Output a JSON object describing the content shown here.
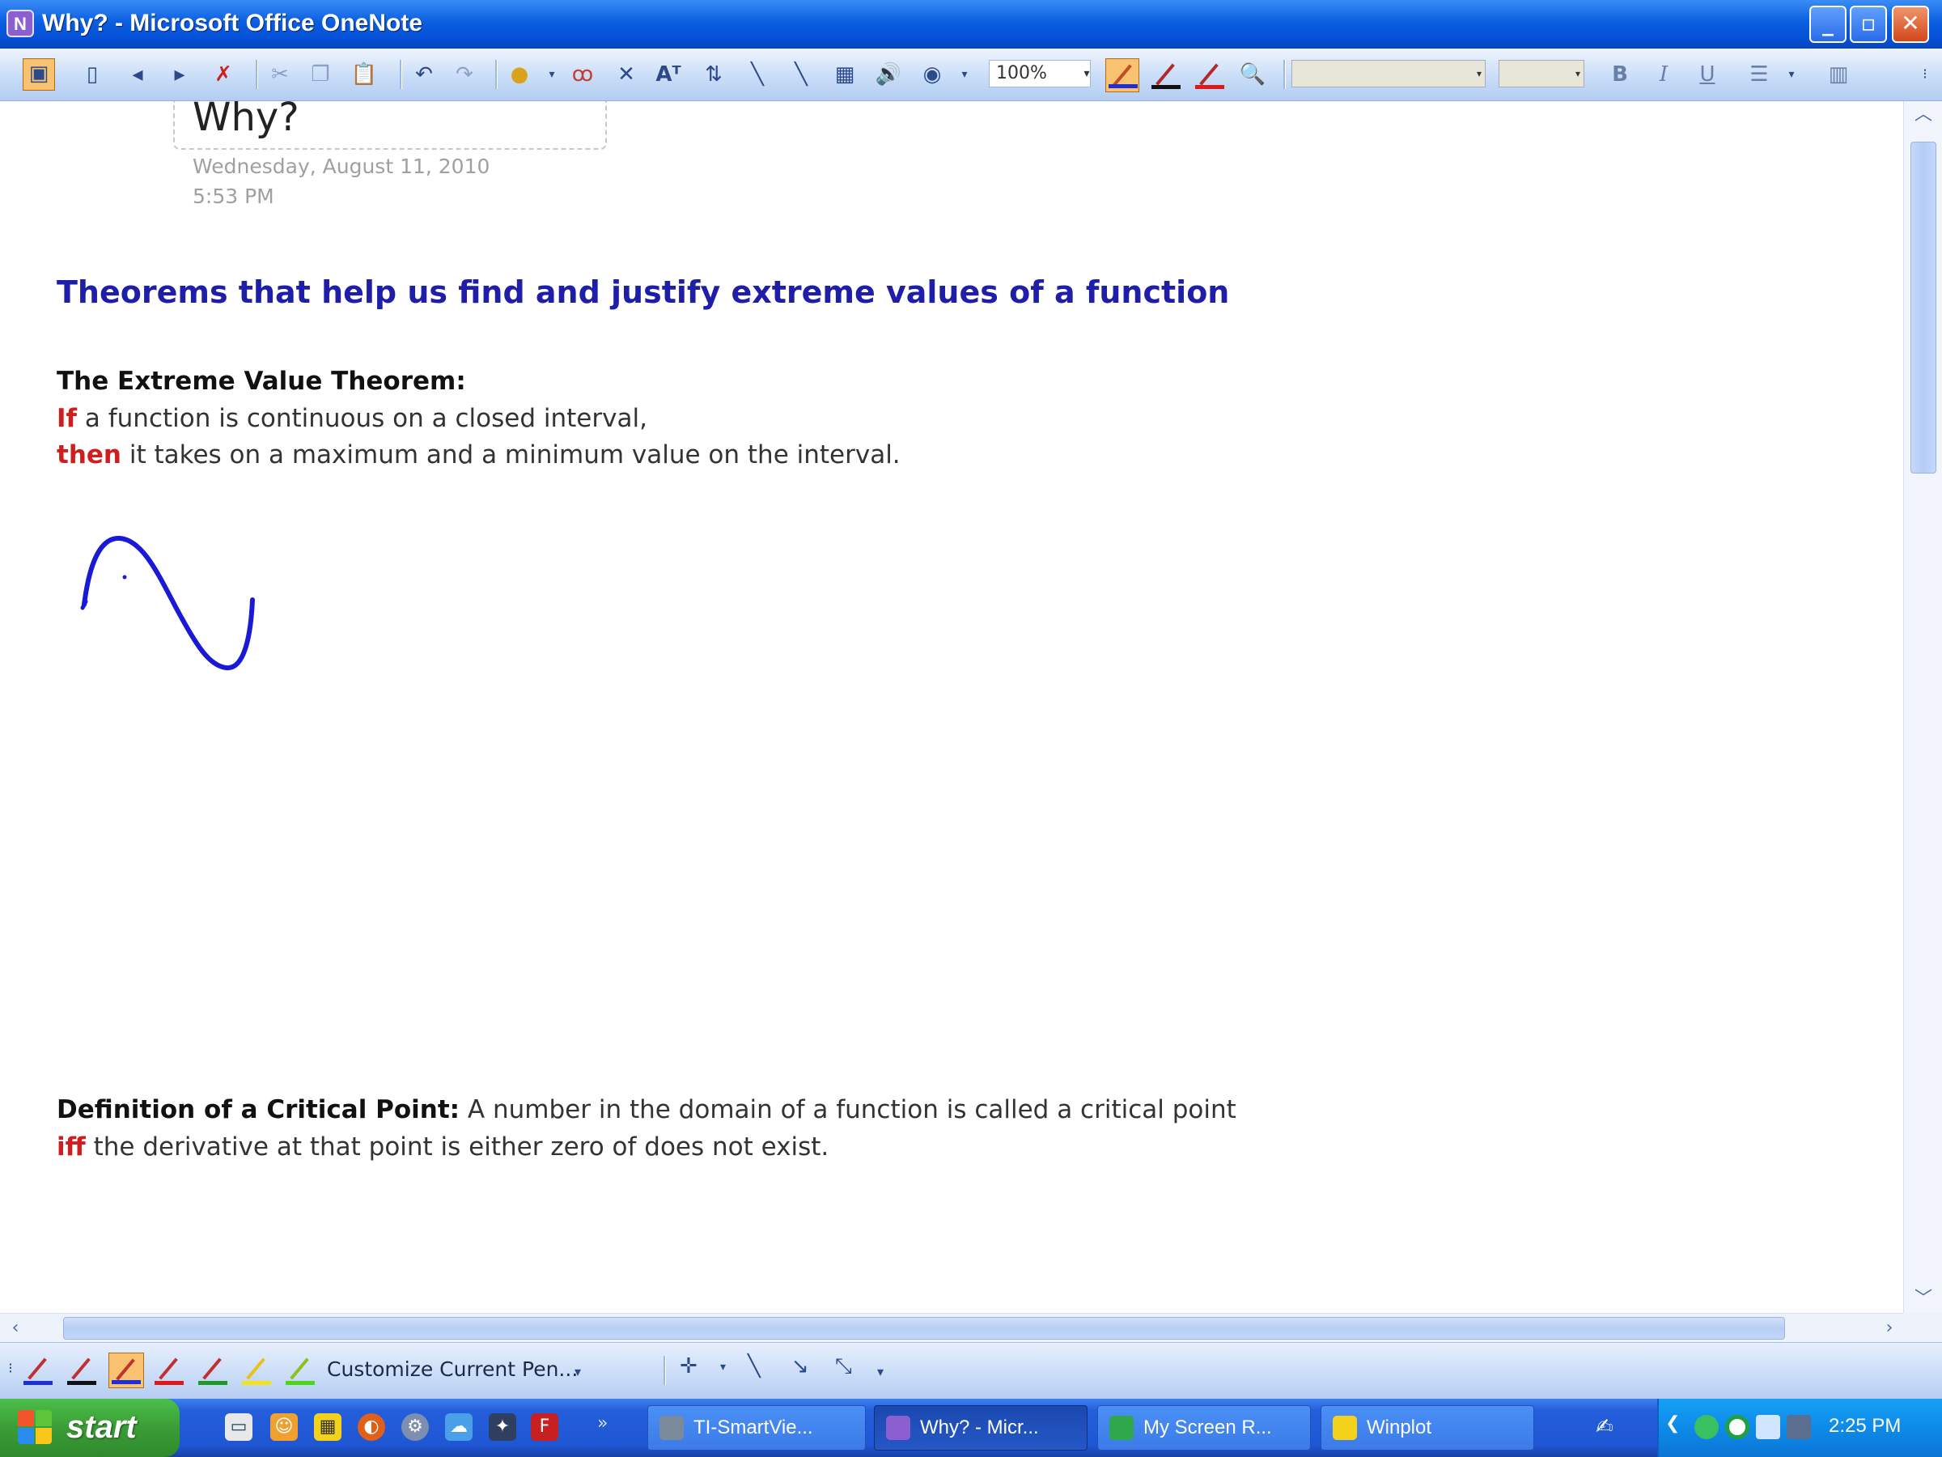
{
  "window": {
    "title": "Why? - Microsoft Office OneNote",
    "app_icon": "onenote-icon"
  },
  "toolbar": {
    "zoom": "100%",
    "font": "",
    "font_size": ""
  },
  "page": {
    "title": "Why?",
    "date": "Wednesday, August 11, 2010",
    "time": "5:53 PM",
    "heading": "Theorems that help us find and justify extreme values of a function",
    "evt_title": "The Extreme Value Theorem:",
    "evt_if": "If",
    "evt_line1_rest": " a function is continuous on a closed interval,",
    "evt_then": "then",
    "evt_line2_rest": " it takes on a maximum and a minimum value on the interval.",
    "crit_title": "Definition of a Critical Point:",
    "crit_line1_rest": " A number in the domain of a function is called a critical point",
    "crit_iff": "iff",
    "crit_line2_rest": " the derivative at that point is either zero of does not exist."
  },
  "pen_toolbar": {
    "customize_label": "Customize Current Pen..."
  },
  "taskbar": {
    "start_label": "start",
    "tasks": [
      {
        "label": "TI-SmartVie..."
      },
      {
        "label": "Why? - Micr..."
      },
      {
        "label": "My Screen R..."
      },
      {
        "label": "Winplot"
      }
    ],
    "clock": "2:25 PM"
  },
  "colors": {
    "heading": "#1e1ea8",
    "keyword_red": "#d01e1e",
    "ink_blue": "#1a1ad6"
  }
}
